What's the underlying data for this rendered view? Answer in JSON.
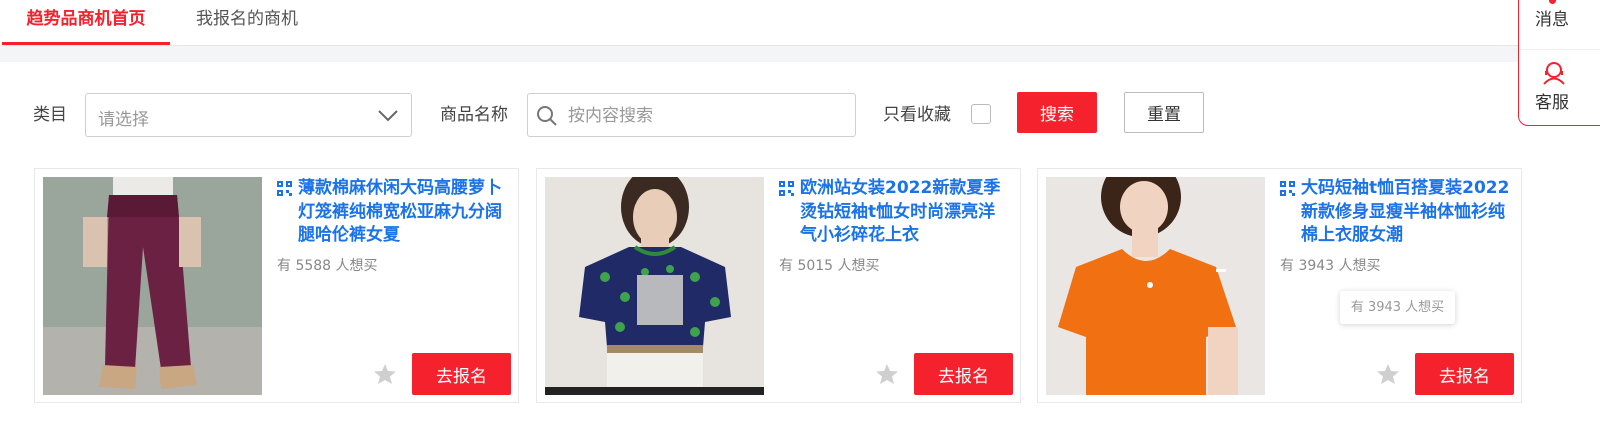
{
  "tabs": [
    {
      "label": "趋势品商机首页",
      "active": true
    },
    {
      "label": "我报名的商机",
      "active": false
    }
  ],
  "filters": {
    "category_label": "类目",
    "category_placeholder": "请选择",
    "product_name_label": "商品名称",
    "product_name_placeholder": "按内容搜索",
    "favorites_only_label": "只看收藏",
    "favorites_only_checked": false,
    "search_button": "搜索",
    "reset_button": "重置"
  },
  "products": [
    {
      "title": "薄款棉麻休闲大码高腰萝卜灯笼裤纯棉宽松亚麻九分阔腿哈伦裤女夏",
      "want": "有 5588 人想买",
      "join_button": "去报名",
      "image": "purple-linen-pants"
    },
    {
      "title": "欧洲站女装2022新款夏季烫钻短袖t恤女时尚漂亮洋气小衫碎花上衣",
      "want": "有 5015 人想买",
      "join_button": "去报名",
      "image": "navy-floral-tshirt"
    },
    {
      "title": "大码短袖t恤百搭夏装2022新款修身显瘦半袖体恤衫纯棉上衣服女潮",
      "want": "有 3943 人想买",
      "join_button": "去报名",
      "image": "orange-tshirt"
    }
  ],
  "tooltip": "有 3943 人想买",
  "float_bar": {
    "message": "消息",
    "service": "客服"
  },
  "colors": {
    "accent": "#f5222d",
    "link": "#1a73e8"
  }
}
